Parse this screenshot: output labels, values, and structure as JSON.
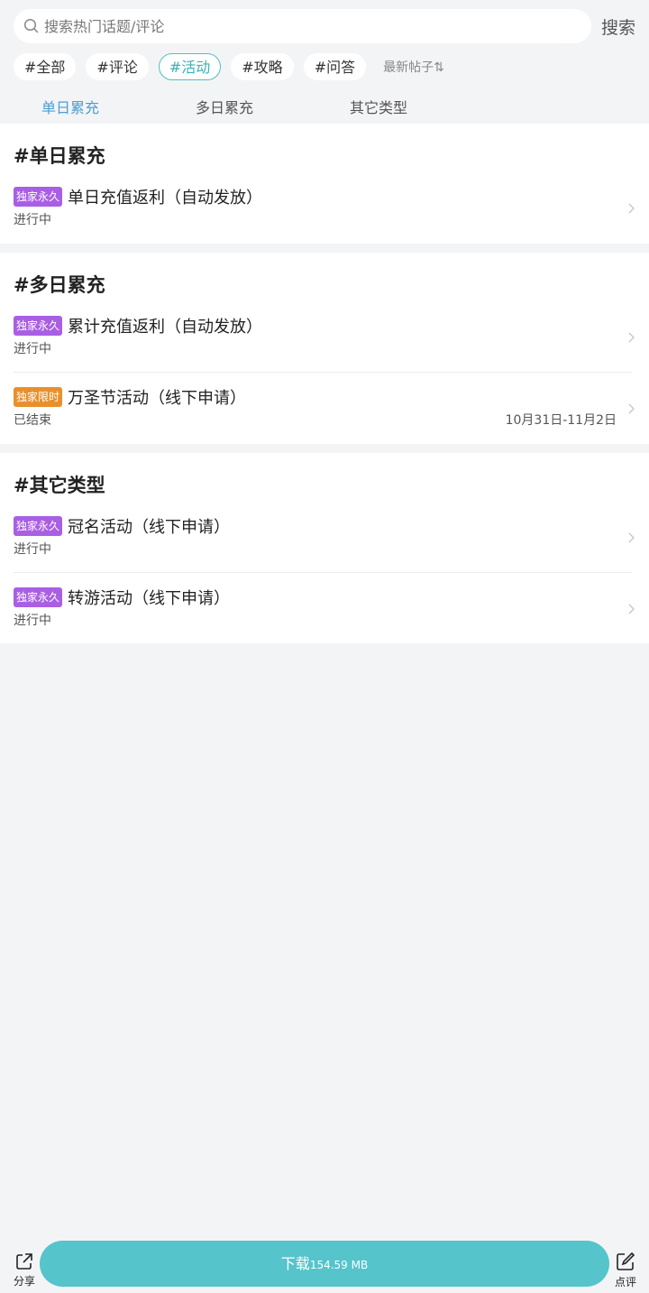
{
  "search": {
    "placeholder": "搜索热门话题/评论",
    "button_label": "搜索"
  },
  "tags": [
    {
      "label": "#全部",
      "active": false
    },
    {
      "label": "#评论",
      "active": false
    },
    {
      "label": "#活动",
      "active": true
    },
    {
      "label": "#攻略",
      "active": false
    },
    {
      "label": "#问答",
      "active": false
    }
  ],
  "sort_label": "最新帖子⇅",
  "subtabs": [
    {
      "label": "单日累充",
      "active": true
    },
    {
      "label": "多日累充",
      "active": false
    },
    {
      "label": "其它类型",
      "active": false
    }
  ],
  "sections": [
    {
      "title": "#单日累充",
      "items": [
        {
          "badge": "独家永久",
          "badge_color": "#a95fe3",
          "title": "单日充值返利（自动发放）",
          "status": "进行中",
          "date": ""
        }
      ]
    },
    {
      "title": "#多日累充",
      "items": [
        {
          "badge": "独家永久",
          "badge_color": "#a95fe3",
          "title": "累计充值返利（自动发放）",
          "status": "进行中",
          "date": ""
        },
        {
          "badge": "独家限时",
          "badge_color": "#e8902c",
          "title": "万圣节活动（线下申请）",
          "status": "已结束",
          "date": "10月31日-11月2日"
        }
      ]
    },
    {
      "title": "#其它类型",
      "items": [
        {
          "badge": "独家永久",
          "badge_color": "#a95fe3",
          "title": "冠名活动（线下申请）",
          "status": "进行中",
          "date": ""
        },
        {
          "badge": "独家永久",
          "badge_color": "#a95fe3",
          "title": "转游活动（线下申请）",
          "status": "进行中",
          "date": ""
        }
      ]
    }
  ],
  "bottom": {
    "share_label": "分享",
    "download_label": "下载",
    "download_size": "154.59 MB",
    "review_label": "点评"
  },
  "colors": {
    "accent": "#55c4cb",
    "active_tab": "#4a9ed6",
    "badge_purple": "#a95fe3",
    "badge_orange": "#e8902c"
  }
}
